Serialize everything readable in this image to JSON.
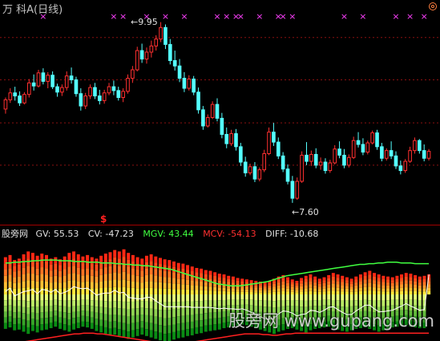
{
  "header": {
    "title": "万  科A(日线)",
    "title_color": "#c0c0c0",
    "bullseye_icon": "bullseye-icon"
  },
  "markers": {
    "cross_color": "#ff40ff",
    "cross_glyph": "×",
    "signal_glyph": "$",
    "signal_color": "#ff2020"
  },
  "chart_data": [
    {
      "type": "candlestick",
      "title": "万  科A(日线)",
      "annotations": {
        "high_label": "9.95",
        "low_label": "7.60",
        "high_prefix": "←",
        "low_prefix": "←"
      },
      "high_value": 9.95,
      "low_value": 7.6,
      "ylim": [
        7.4,
        10.05
      ],
      "grid": true,
      "grid_levels": [
        9.75,
        9.2,
        8.64,
        8.09
      ],
      "up_color": "#ff3030",
      "down_color": "#54ffff",
      "candles": [
        [
          8.82,
          8.97,
          8.76,
          8.94
        ],
        [
          8.94,
          9.09,
          8.9,
          9.03
        ],
        [
          9.03,
          9.11,
          8.93,
          8.99
        ],
        [
          8.99,
          9.05,
          8.86,
          8.9
        ],
        [
          8.9,
          9.04,
          8.88,
          9.01
        ],
        [
          9.01,
          9.21,
          8.97,
          9.16
        ],
        [
          9.16,
          9.27,
          9.06,
          9.12
        ],
        [
          9.12,
          9.33,
          9.1,
          9.29
        ],
        [
          9.29,
          9.35,
          9.14,
          9.18
        ],
        [
          9.18,
          9.3,
          9.09,
          9.26
        ],
        [
          9.26,
          9.31,
          9.08,
          9.11
        ],
        [
          9.11,
          9.15,
          8.98,
          9.04
        ],
        [
          9.04,
          9.14,
          8.99,
          9.1
        ],
        [
          9.1,
          9.31,
          9.06,
          9.25
        ],
        [
          9.25,
          9.36,
          9.15,
          9.2
        ],
        [
          9.2,
          9.24,
          8.98,
          9.02
        ],
        [
          9.02,
          9.09,
          8.8,
          8.86
        ],
        [
          8.86,
          9.03,
          8.82,
          8.99
        ],
        [
          8.99,
          9.14,
          8.95,
          9.1
        ],
        [
          9.1,
          9.16,
          8.95,
          8.99
        ],
        [
          8.99,
          9.07,
          8.88,
          8.93
        ],
        [
          8.93,
          9.07,
          8.89,
          9.03
        ],
        [
          9.03,
          9.16,
          9.0,
          9.11
        ],
        [
          9.11,
          9.19,
          9.0,
          9.06
        ],
        [
          9.06,
          9.11,
          8.93,
          8.97
        ],
        [
          8.97,
          9.09,
          8.91,
          9.05
        ],
        [
          9.05,
          9.27,
          9.02,
          9.22
        ],
        [
          9.22,
          9.38,
          9.16,
          9.33
        ],
        [
          9.33,
          9.63,
          9.31,
          9.58
        ],
        [
          9.58,
          9.67,
          9.42,
          9.47
        ],
        [
          9.47,
          9.62,
          9.41,
          9.56
        ],
        [
          9.56,
          9.71,
          9.49,
          9.64
        ],
        [
          9.64,
          9.78,
          9.58,
          9.73
        ],
        [
          9.73,
          9.95,
          9.69,
          9.88
        ],
        [
          9.88,
          9.92,
          9.6,
          9.66
        ],
        [
          9.66,
          9.73,
          9.4,
          9.45
        ],
        [
          9.45,
          9.58,
          9.32,
          9.38
        ],
        [
          9.38,
          9.47,
          9.17,
          9.22
        ],
        [
          9.22,
          9.3,
          9.04,
          9.09
        ],
        [
          9.09,
          9.26,
          9.06,
          9.21
        ],
        [
          9.21,
          9.25,
          9.0,
          9.04
        ],
        [
          9.04,
          9.1,
          8.76,
          8.81
        ],
        [
          8.81,
          8.86,
          8.55,
          8.6
        ],
        [
          8.6,
          8.75,
          8.58,
          8.71
        ],
        [
          8.71,
          8.92,
          8.69,
          8.88
        ],
        [
          8.88,
          8.96,
          8.66,
          8.7
        ],
        [
          8.7,
          8.77,
          8.44,
          8.49
        ],
        [
          8.49,
          8.58,
          8.31,
          8.37
        ],
        [
          8.37,
          8.55,
          8.34,
          8.5
        ],
        [
          8.5,
          8.56,
          8.28,
          8.33
        ],
        [
          8.33,
          8.38,
          8.08,
          8.13
        ],
        [
          8.13,
          8.2,
          7.94,
          7.99
        ],
        [
          7.99,
          8.11,
          7.96,
          8.07
        ],
        [
          8.07,
          8.13,
          7.87,
          7.91
        ],
        [
          7.91,
          8.06,
          7.88,
          8.03
        ],
        [
          8.03,
          8.29,
          8.0,
          8.24
        ],
        [
          8.24,
          8.58,
          8.22,
          8.52
        ],
        [
          8.52,
          8.64,
          8.34,
          8.39
        ],
        [
          8.39,
          8.45,
          8.17,
          8.21
        ],
        [
          8.21,
          8.26,
          8.0,
          8.04
        ],
        [
          8.04,
          8.1,
          7.84,
          7.88
        ],
        [
          7.88,
          7.95,
          7.6,
          7.66
        ],
        [
          7.66,
          7.93,
          7.64,
          7.88
        ],
        [
          7.88,
          8.27,
          7.86,
          8.22
        ],
        [
          8.22,
          8.39,
          8.09,
          8.14
        ],
        [
          8.14,
          8.28,
          8.08,
          8.23
        ],
        [
          8.23,
          8.31,
          8.05,
          8.09
        ],
        [
          8.09,
          8.19,
          8.03,
          8.13
        ],
        [
          8.13,
          8.18,
          7.98,
          8.02
        ],
        [
          8.02,
          8.16,
          7.99,
          8.12
        ],
        [
          8.12,
          8.35,
          8.1,
          8.3
        ],
        [
          8.3,
          8.4,
          8.18,
          8.22
        ],
        [
          8.22,
          8.3,
          8.05,
          8.09
        ],
        [
          8.09,
          8.23,
          8.06,
          8.19
        ],
        [
          8.19,
          8.46,
          8.17,
          8.41
        ],
        [
          8.41,
          8.52,
          8.32,
          8.36
        ],
        [
          8.36,
          8.44,
          8.22,
          8.26
        ],
        [
          8.26,
          8.41,
          8.23,
          8.38
        ],
        [
          8.38,
          8.54,
          8.36,
          8.51
        ],
        [
          8.51,
          8.55,
          8.29,
          8.33
        ],
        [
          8.33,
          8.38,
          8.14,
          8.18
        ],
        [
          8.18,
          8.31,
          8.15,
          8.28
        ],
        [
          8.28,
          8.4,
          8.17,
          8.21
        ],
        [
          8.21,
          8.27,
          8.04,
          8.08
        ],
        [
          8.08,
          8.15,
          7.97,
          8.02
        ],
        [
          8.02,
          8.17,
          7.99,
          8.14
        ],
        [
          8.14,
          8.33,
          8.12,
          8.28
        ],
        [
          8.28,
          8.45,
          8.24,
          8.41
        ],
        [
          8.41,
          8.43,
          8.24,
          8.28
        ],
        [
          8.28,
          8.36,
          8.14,
          8.18
        ],
        [
          8.18,
          8.3,
          8.15,
          8.27
        ]
      ]
    },
    {
      "type": "bar",
      "title": "股旁网",
      "legend": [
        {
          "label": "GV: 55.53",
          "color": "#e0e0e0"
        },
        {
          "label": "CV: -47.23",
          "color": "#e0e0e0"
        },
        {
          "label": "MGV: 43.44",
          "color": "#40ff40"
        },
        {
          "label": "MCV: -54.13",
          "color": "#ff3030"
        },
        {
          "label": "DIFF: -10.68",
          "color": "#e0e0e0"
        }
      ],
      "ylim": [
        -75,
        75
      ],
      "gv": [
        52,
        55,
        48,
        50,
        56,
        60,
        58,
        54,
        57,
        55,
        50,
        52,
        49,
        53,
        58,
        60,
        56,
        53,
        55,
        52,
        50,
        54,
        57,
        59,
        62,
        60,
        63,
        58,
        55,
        52,
        50,
        54,
        56,
        53,
        51,
        49,
        48,
        46,
        44,
        43,
        41,
        39,
        37,
        36,
        34,
        33,
        31,
        29,
        28,
        26,
        25,
        23,
        22,
        21,
        20,
        19,
        18,
        17,
        19,
        22,
        25,
        27,
        24,
        21,
        19,
        23,
        26,
        28,
        25,
        22,
        24,
        27,
        30,
        28,
        26,
        24,
        22,
        25,
        28,
        31,
        33,
        30,
        28,
        26,
        25,
        24,
        26,
        28,
        30,
        29,
        27,
        25,
        26,
        28
      ],
      "cv": [
        -48,
        -46,
        -50,
        -49,
        -52,
        -55,
        -51,
        -53,
        -50,
        -49,
        -47,
        -45,
        -48,
        -50,
        -52,
        -49,
        -47,
        -45,
        -46,
        -48,
        -51,
        -53,
        -55,
        -57,
        -56,
        -58,
        -60,
        -62,
        -60,
        -58,
        -56,
        -58,
        -60,
        -62,
        -64,
        -66,
        -65,
        -63,
        -61,
        -60,
        -58,
        -57,
        -55,
        -54,
        -52,
        -51,
        -50,
        -49,
        -47,
        -46,
        -45,
        -44,
        -42,
        -43,
        -45,
        -47,
        -49,
        -51,
        -53,
        -55,
        -52,
        -50,
        -48,
        -47,
        -49,
        -51,
        -53,
        -50,
        -48,
        -47,
        -46,
        -45,
        -47,
        -49,
        -51,
        -52,
        -50,
        -48,
        -47,
        -46,
        -48,
        -50,
        -52,
        -50,
        -48,
        -46,
        -45,
        -44,
        -43,
        -45,
        -46,
        -47,
        -47
      ],
      "mgv": [
        44,
        44,
        45,
        45,
        46,
        46,
        47,
        47,
        48,
        48,
        48,
        48,
        47,
        47,
        47,
        46,
        46,
        46,
        45,
        45,
        45,
        44,
        44,
        44,
        43,
        43,
        42,
        42,
        41,
        41,
        40,
        40,
        39,
        38,
        37,
        36,
        35,
        33,
        31,
        29,
        27,
        25,
        23,
        21,
        19,
        17,
        15,
        14,
        13,
        12,
        12,
        12,
        13,
        14,
        15,
        16,
        17,
        18,
        20,
        22,
        24,
        26,
        27,
        28,
        29,
        30,
        31,
        32,
        33,
        34,
        35,
        36,
        37,
        38,
        39,
        40,
        41,
        42,
        42,
        43,
        43,
        44,
        44,
        45,
        45,
        45,
        44,
        44,
        44,
        43,
        43,
        43,
        43
      ],
      "mcv": [
        -70,
        -69,
        -68,
        -67,
        -66,
        -65,
        -64,
        -63,
        -62,
        -61,
        -60,
        -59,
        -58,
        -57,
        -56,
        -55,
        -55,
        -54,
        -54,
        -54,
        -55,
        -55,
        -56,
        -57,
        -58,
        -59,
        -60,
        -61,
        -62,
        -63,
        -64,
        -65,
        -66,
        -67,
        -68,
        -69,
        -70,
        -70,
        -69,
        -68,
        -67,
        -66,
        -65,
        -64,
        -63,
        -62,
        -61,
        -60,
        -59,
        -58,
        -57,
        -56,
        -55,
        -55,
        -55,
        -55,
        -56,
        -56,
        -57,
        -57,
        -56,
        -55,
        -55,
        -54,
        -54,
        -54,
        -54,
        -54,
        -54,
        -54,
        -54,
        -54,
        -54,
        -54,
        -54,
        -54,
        -54,
        -54,
        -54,
        -54,
        -54,
        -54,
        -54,
        -54,
        -54,
        -54,
        -54,
        -54,
        -54,
        -54,
        -54,
        -54,
        -54
      ]
    }
  ],
  "watermark": "股旁网 www.gupang.com"
}
